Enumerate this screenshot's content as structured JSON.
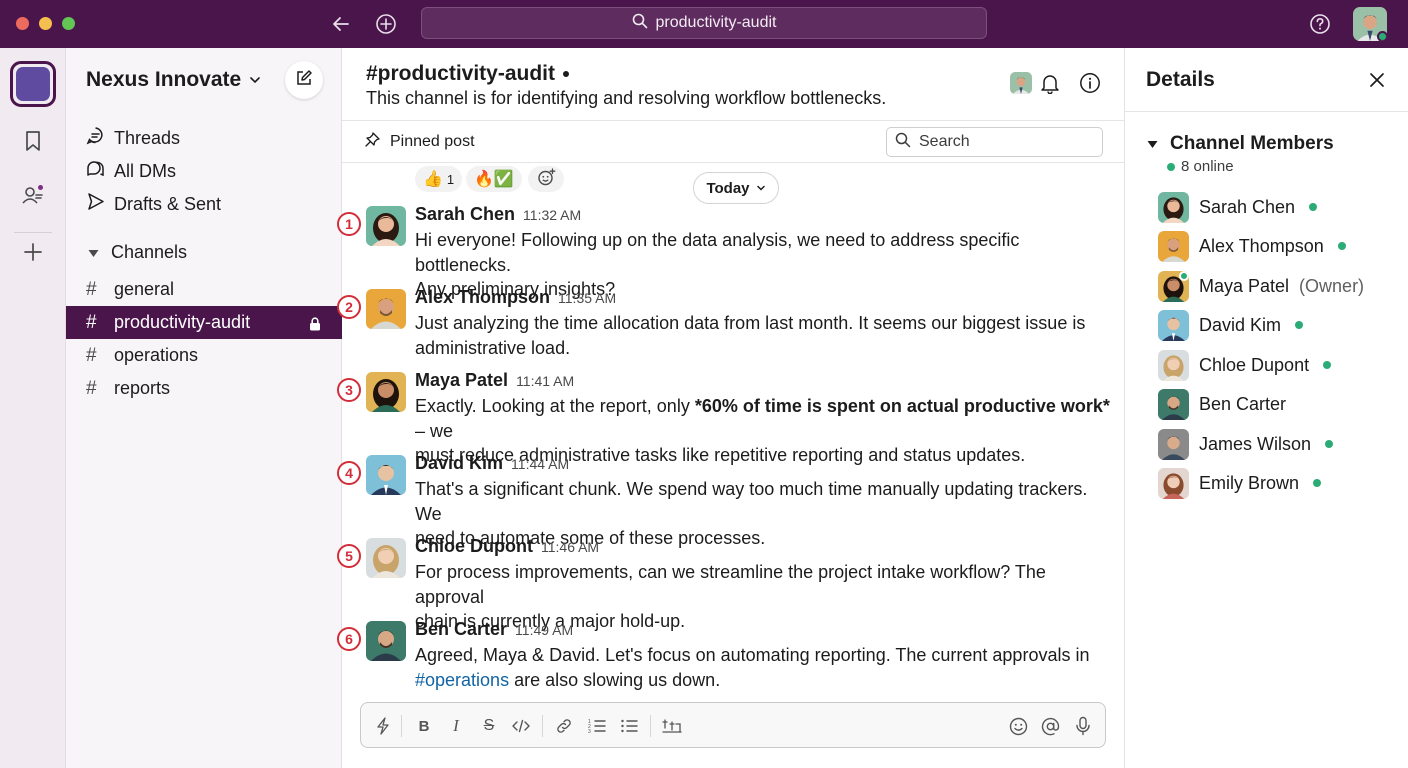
{
  "colors": {
    "aubergine": "#4a154b",
    "online_green": "#2bac76",
    "link_blue": "#1264a3",
    "annotation_red": "#d12e3a"
  },
  "titlebar": {
    "search_text": "productivity-audit",
    "icons": [
      "back-arrow-icon",
      "plus-circle-icon",
      "search-icon",
      "help-icon",
      "user-avatar"
    ]
  },
  "workspace": {
    "name": "Nexus Innovate"
  },
  "sidebar": {
    "nav": [
      {
        "label": "Threads",
        "icon": "threads-icon"
      },
      {
        "label": "All DMs",
        "icon": "dms-icon"
      },
      {
        "label": "Drafts & Sent",
        "icon": "send-icon"
      }
    ],
    "channels_header": "Channels",
    "channels": [
      {
        "name": "general",
        "active": false
      },
      {
        "name": "productivity-audit",
        "active": true,
        "locked": true
      },
      {
        "name": "operations",
        "active": false
      },
      {
        "name": "reports",
        "active": false
      }
    ]
  },
  "channel": {
    "title": "#productivity-audit",
    "description": "This channel is for identifying and resolving workflow bottlenecks.",
    "pinned_label": "Pinned post",
    "search_placeholder": "Search",
    "date_divider": "Today",
    "reactions": [
      {
        "emoji": "👍",
        "count": "1"
      },
      {
        "emoji": "🔥✅",
        "count": ""
      }
    ]
  },
  "messages": [
    {
      "index": "1",
      "author": "Sarah Chen",
      "time": "11:32 AM",
      "lines": [
        "Hi everyone! Following up on the data analysis, we need to address specific bottlenecks.",
        "Any preliminary insights?"
      ]
    },
    {
      "index": "2",
      "author": "Alex Thompson",
      "time": "11:35 AM",
      "lines": [
        "Just analyzing the time allocation data from last month. It seems our biggest issue is",
        "administrative load."
      ]
    },
    {
      "index": "3",
      "author": "Maya Patel",
      "time": "11:41 AM",
      "line1_a": "Exactly. Looking at the report, only ",
      "line1_bold": "*60% of time is spent on actual productive work*",
      "line1_b": " – we",
      "line2": "must reduce administrative tasks like repetitive reporting and status updates."
    },
    {
      "index": "4",
      "author": "David Kim",
      "time": "11:44 AM",
      "lines": [
        "That's a significant chunk. We spend way too much time manually updating trackers. We",
        "need to automate some of these processes."
      ]
    },
    {
      "index": "5",
      "author": "Chloe Dupont",
      "time": "11:46 AM",
      "lines": [
        "For process improvements, can we streamline the project intake workflow? The approval",
        "chain is currently a major hold-up."
      ]
    },
    {
      "index": "6",
      "author": "Ben Carter",
      "time": "11:49 AM",
      "line1": "Agreed, Maya & David. Let's focus on automating reporting. The current approvals in",
      "line2_link": "#operations",
      "line2_rest": " are also slowing us down."
    }
  ],
  "composer": {
    "tools": [
      "shortcuts-icon",
      "bold-icon",
      "italic-icon",
      "strikethrough-icon",
      "code-icon",
      "link-icon",
      "numbered-list-icon",
      "bulleted-list-icon",
      "code-block-icon",
      "emoji-icon",
      "mention-icon",
      "microphone-icon"
    ]
  },
  "details": {
    "title": "Details",
    "members_header": "Channel Members",
    "online_count": "8 online",
    "members": [
      {
        "name": "Sarah Chen",
        "online": true
      },
      {
        "name": "Alex Thompson",
        "online": true
      },
      {
        "name": "Maya Patel",
        "role": "(Owner)",
        "online": true
      },
      {
        "name": "David Kim",
        "online": true
      },
      {
        "name": "Chloe Dupont",
        "online": true
      },
      {
        "name": "Ben Carter",
        "online": false
      },
      {
        "name": "James Wilson",
        "online": true
      },
      {
        "name": "Emily Brown",
        "online": true
      }
    ]
  }
}
